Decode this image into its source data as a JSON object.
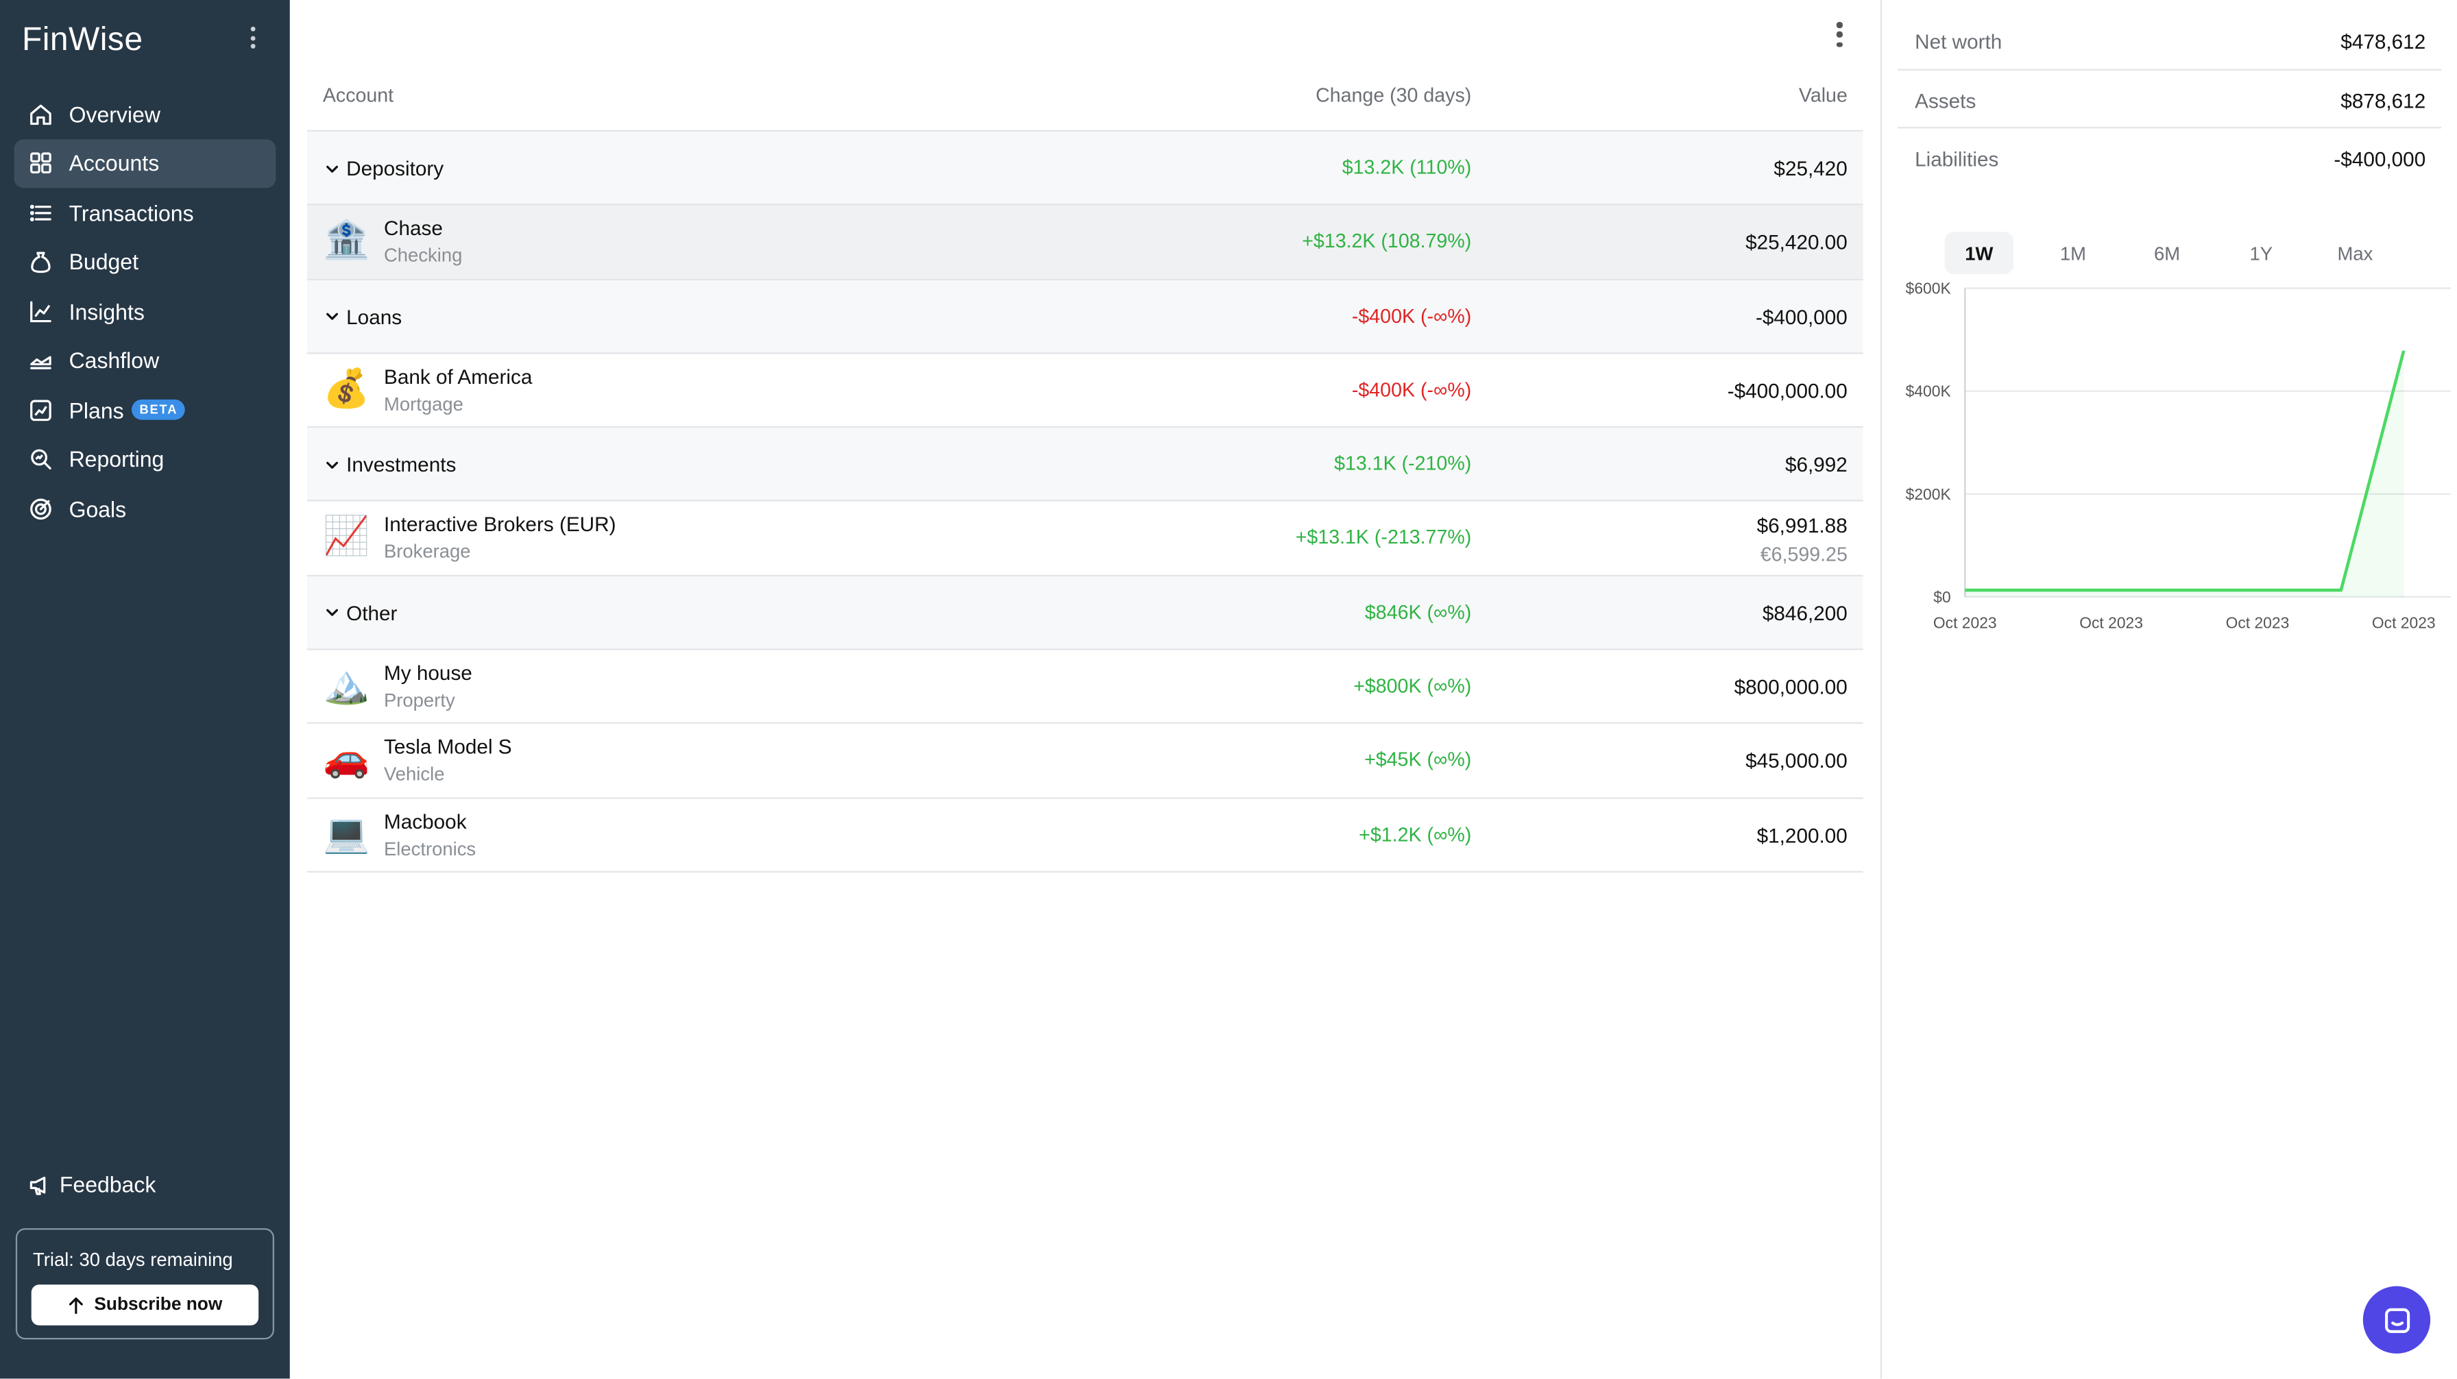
{
  "app": {
    "name": "FinWise"
  },
  "sidebar": {
    "items": [
      {
        "label": "Overview",
        "icon": "home-icon"
      },
      {
        "label": "Accounts",
        "icon": "grid-icon"
      },
      {
        "label": "Transactions",
        "icon": "list-icon"
      },
      {
        "label": "Budget",
        "icon": "bag-icon"
      },
      {
        "label": "Insights",
        "icon": "line-chart-icon"
      },
      {
        "label": "Cashflow",
        "icon": "area-chart-icon"
      },
      {
        "label": "Plans",
        "icon": "trend-chart-icon",
        "badge": "BETA"
      },
      {
        "label": "Reporting",
        "icon": "search-chart-icon"
      },
      {
        "label": "Goals",
        "icon": "target-icon"
      }
    ],
    "active_item": "Accounts",
    "feedback_label": "Feedback",
    "trial_text": "Trial: 30 days remaining",
    "subscribe_label": "Subscribe now"
  },
  "table": {
    "headers": {
      "account": "Account",
      "change": "Change (30 days)",
      "value": "Value"
    },
    "groups": [
      {
        "name": "Depository",
        "change": "$13.2K (110%)",
        "change_sign": "positive",
        "value": "$25,420",
        "accounts": [
          {
            "name": "Chase",
            "type": "Checking",
            "icon": "bank-icon",
            "change": "+$13.2K (108.79%)",
            "change_sign": "positive",
            "value": "$25,420.00",
            "value_secondary": ""
          }
        ]
      },
      {
        "name": "Loans",
        "change": "-$400K (-∞%)",
        "change_sign": "negative",
        "value": "-$400,000",
        "accounts": [
          {
            "name": "Bank of America",
            "type": "Mortgage",
            "icon": "money-bag-icon",
            "change": "-$400K (-∞%)",
            "change_sign": "negative",
            "value": "-$400,000.00",
            "value_secondary": ""
          }
        ]
      },
      {
        "name": "Investments",
        "change": "$13.1K (-210%)",
        "change_sign": "positive",
        "value": "$6,992",
        "accounts": [
          {
            "name": "Interactive Brokers (EUR)",
            "type": "Brokerage",
            "icon": "chart-increasing-icon",
            "change": "+$13.1K (-213.77%)",
            "change_sign": "positive",
            "value": "$6,991.88",
            "value_secondary": "€6,599.25"
          }
        ]
      },
      {
        "name": "Other",
        "change": "$846K (∞%)",
        "change_sign": "positive",
        "value": "$846,200",
        "accounts": [
          {
            "name": "My house",
            "type": "Property",
            "icon": "mountain-icon",
            "change": "+$800K (∞%)",
            "change_sign": "positive",
            "value": "$800,000.00",
            "value_secondary": ""
          },
          {
            "name": "Tesla Model S",
            "type": "Vehicle",
            "icon": "car-icon",
            "change": "+$45K (∞%)",
            "change_sign": "positive",
            "value": "$45,000.00",
            "value_secondary": ""
          },
          {
            "name": "Macbook",
            "type": "Electronics",
            "icon": "laptop-icon",
            "change": "+$1.2K (∞%)",
            "change_sign": "positive",
            "value": "$1,200.00",
            "value_secondary": ""
          }
        ]
      }
    ]
  },
  "summary": {
    "net_worth_label": "Net worth",
    "net_worth": "$478,612",
    "assets_label": "Assets",
    "assets": "$878,612",
    "liabilities_label": "Liabilities",
    "liabilities": "-$400,000"
  },
  "range_tabs": [
    "1W",
    "1M",
    "6M",
    "1Y",
    "Max"
  ],
  "active_range": "1W",
  "colors": {
    "sidebar_bg": "#263746",
    "sidebar_active": "#3d4f5f",
    "positive": "#2fb344",
    "negative": "#e02424",
    "chart_line": "#4cd964",
    "chat_button": "#4f46e5",
    "beta_badge": "#3a8ee6"
  },
  "chart_data": {
    "type": "line",
    "x_tick_labels": [
      "Oct 2023",
      "Oct 2023",
      "Oct 2023",
      "Oct 2023"
    ],
    "y_tick_labels": [
      "$600K",
      "$400K",
      "$200K",
      "$0"
    ],
    "ylim": [
      0,
      600000
    ],
    "series": [
      {
        "values": [
          13000,
          13000,
          13000,
          13000,
          13000,
          13000,
          13000,
          478612
        ]
      }
    ],
    "grid": true,
    "title": "",
    "xlabel": "",
    "ylabel": ""
  }
}
